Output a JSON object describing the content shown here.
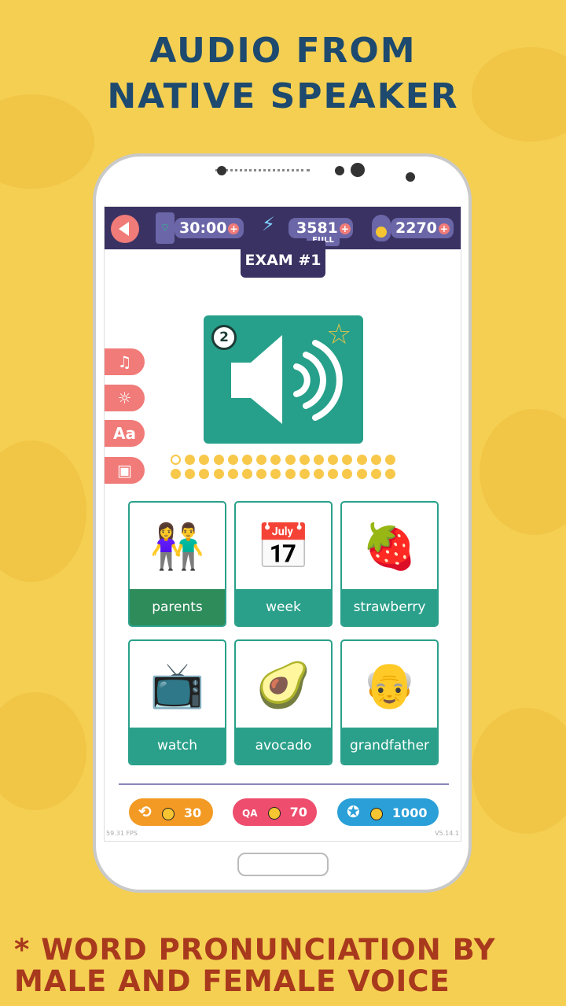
{
  "headline": {
    "line1": "AUDIO FROM",
    "line2": "NATIVE SPEAKER"
  },
  "footer_text": {
    "line1": "* WORD PRONUNCIATION BY",
    "line2": "MALE AND FEMALE VOICE"
  },
  "topbar": {
    "back_icon": "back-arrow-icon",
    "timer": "30:00",
    "energy": "3581",
    "energy_status": "FULL",
    "coins": "2270"
  },
  "exam_title": "EXAM #1",
  "audio_card": {
    "attempts": "2",
    "icon": "speaker-icon",
    "star_icon": "star-outline-icon"
  },
  "side_buttons": [
    "music-off-icon",
    "day-night-icon",
    "font-size-icon",
    "image-icon"
  ],
  "progress": {
    "total": 32,
    "current": 1
  },
  "answers": [
    {
      "label": "parents",
      "emoji": "👫",
      "selected": true
    },
    {
      "label": "week",
      "emoji": "📅",
      "selected": false
    },
    {
      "label": "strawberry",
      "emoji": "🍓",
      "selected": false
    },
    {
      "label": "watch",
      "emoji": "📺",
      "selected": false
    },
    {
      "label": "avocado",
      "emoji": "🥑",
      "selected": false
    },
    {
      "label": "grandfather",
      "emoji": "👴",
      "selected": false
    }
  ],
  "powerups": [
    {
      "icon": "time-rewind-icon",
      "cost": "30",
      "color": "#f39a24"
    },
    {
      "icon": "qa-icon",
      "cost": "70",
      "color": "#ee4d6d"
    },
    {
      "icon": "award-icon",
      "cost": "1000",
      "color": "#2a9fd8"
    }
  ],
  "fps": "59.31 FPS",
  "version": "V5.14.1",
  "colors": {
    "accent": "#2aa08a",
    "topbar": "#3a3262",
    "side": "#f07b78",
    "background": "#f5cf52"
  }
}
